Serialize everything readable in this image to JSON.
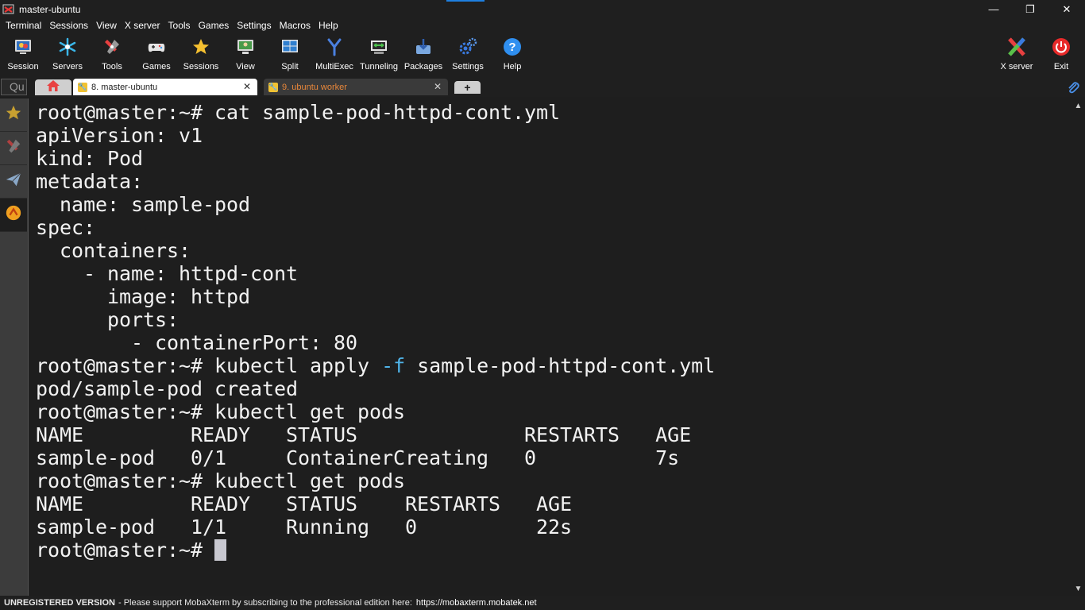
{
  "window": {
    "title": "master-ubuntu",
    "controls": {
      "minimize": "—",
      "maximize": "❐",
      "close": "✕"
    }
  },
  "menu": [
    "Terminal",
    "Sessions",
    "View",
    "X server",
    "Tools",
    "Games",
    "Settings",
    "Macros",
    "Help"
  ],
  "toolbar": {
    "session": "Session",
    "servers": "Servers",
    "tools": "Tools",
    "games": "Games",
    "sessions": "Sessions",
    "view": "View",
    "split": "Split",
    "multiexec": "MultiExec",
    "tunneling": "Tunneling",
    "packages": "Packages",
    "settings": "Settings",
    "help": "Help",
    "xserver": "X server",
    "exit": "Exit"
  },
  "tabs": {
    "quick_connect_placeholder": "Quick connect...",
    "quick_connect_visible": "Qu",
    "active": "8. master-ubuntu",
    "inactive": "9. ubuntu worker",
    "close_glyph": "✕",
    "new_tab_glyph": "+"
  },
  "terminal": {
    "prompt": "root@master:~# ",
    "lines": [
      "root@master:~# cat sample-pod-httpd-cont.yml",
      "apiVersion: v1",
      "kind: Pod",
      "metadata:",
      "  name: sample-pod",
      "spec:",
      "  containers:",
      "    - name: httpd-cont",
      "      image: httpd",
      "      ports:",
      "        - containerPort: 80"
    ],
    "apply_cmd_before": "kubectl apply ",
    "apply_cmd_flag": "-f",
    "apply_cmd_after": " sample-pod-httpd-cont.yml",
    "lines2": [
      "pod/sample-pod created",
      "root@master:~# kubectl get pods",
      "NAME         READY   STATUS              RESTARTS   AGE",
      "sample-pod   0/1     ContainerCreating   0          7s",
      "root@master:~# kubectl get pods",
      "NAME         READY   STATUS    RESTARTS   AGE",
      "sample-pod   1/1     Running   0          22s"
    ],
    "final_prompt": "root@master:~# "
  },
  "status": {
    "label": "UNREGISTERED VERSION",
    "message": " -  Please support MobaXterm by subscribing to the professional edition here:",
    "link": "https://mobaxterm.mobatek.net"
  }
}
